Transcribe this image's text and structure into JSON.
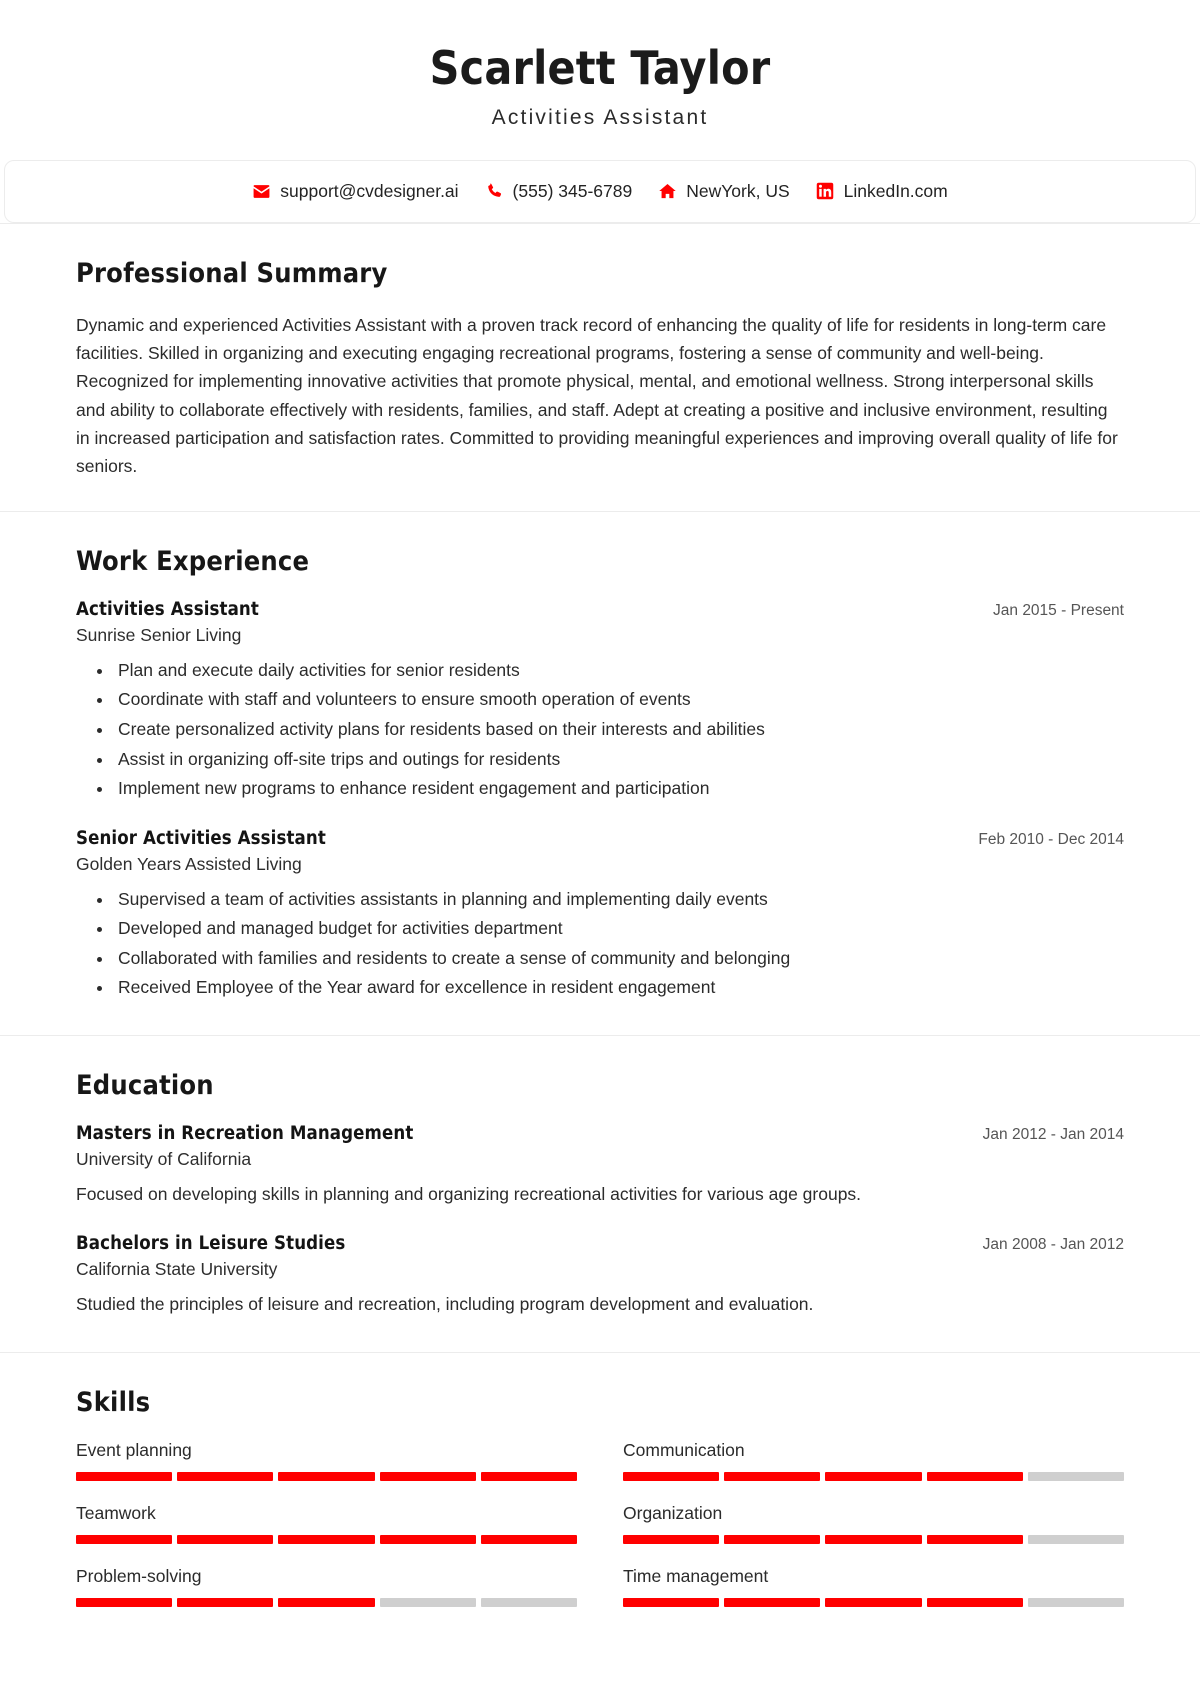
{
  "theme": {
    "accent": "#FF0000",
    "empty": "#CFCFCF",
    "rule": "#ECECEC"
  },
  "header": {
    "name": "Scarlett Taylor",
    "role": "Activities Assistant"
  },
  "contact": {
    "items": [
      {
        "icon": "email-icon",
        "text": "support@cvdesigner.ai"
      },
      {
        "icon": "phone-icon",
        "text": "(555) 345-6789"
      },
      {
        "icon": "location-icon",
        "text": "NewYork, US"
      },
      {
        "icon": "linkedin-icon",
        "text": "LinkedIn.com"
      }
    ]
  },
  "summary": {
    "title": "Professional Summary",
    "text": "Dynamic and experienced Activities Assistant with a proven track record of enhancing the quality of life for residents in long-term care facilities. Skilled in organizing and executing engaging recreational programs, fostering a sense of community and well-being. Recognized for implementing innovative activities that promote physical, mental, and emotional wellness. Strong interpersonal skills and ability to collaborate effectively with residents, families, and staff. Adept at creating a positive and inclusive environment, resulting in increased participation and satisfaction rates. Committed to providing meaningful experiences and improving overall quality of life for seniors."
  },
  "work": {
    "title": "Work Experience",
    "entries": [
      {
        "title": "Activities Assistant",
        "company": "Sunrise Senior Living",
        "date": "Jan 2015 - Present",
        "bullets": [
          "Plan and execute daily activities for senior residents",
          "Coordinate with staff and volunteers to ensure smooth operation of events",
          "Create personalized activity plans for residents based on their interests and abilities",
          "Assist in organizing off-site trips and outings for residents",
          "Implement new programs to enhance resident engagement and participation"
        ]
      },
      {
        "title": "Senior Activities Assistant",
        "company": "Golden Years Assisted Living",
        "date": "Feb 2010 - Dec 2014",
        "bullets": [
          "Supervised a team of activities assistants in planning and implementing daily events",
          "Developed and managed budget for activities department",
          "Collaborated with families and residents to create a sense of community and belonging",
          "Received Employee of the Year award for excellence in resident engagement"
        ]
      }
    ]
  },
  "education": {
    "title": "Education",
    "entries": [
      {
        "title": "Masters in Recreation Management",
        "school": "University of California",
        "date": "Jan 2012 - Jan 2014",
        "description": "Focused on developing skills in planning and organizing recreational activities for various age groups."
      },
      {
        "title": "Bachelors in Leisure Studies",
        "school": "California State University",
        "date": "Jan 2008 - Jan 2012",
        "description": "Studied the principles of leisure and recreation, including program development and evaluation."
      }
    ]
  },
  "skills": {
    "title": "Skills",
    "segments_total": 5,
    "items": [
      {
        "label": "Event planning",
        "filled": 5
      },
      {
        "label": "Communication",
        "filled": 4
      },
      {
        "label": "Teamwork",
        "filled": 5
      },
      {
        "label": "Organization",
        "filled": 4
      },
      {
        "label": "Problem-solving",
        "filled": 3
      },
      {
        "label": "Time management",
        "filled": 4
      }
    ]
  }
}
